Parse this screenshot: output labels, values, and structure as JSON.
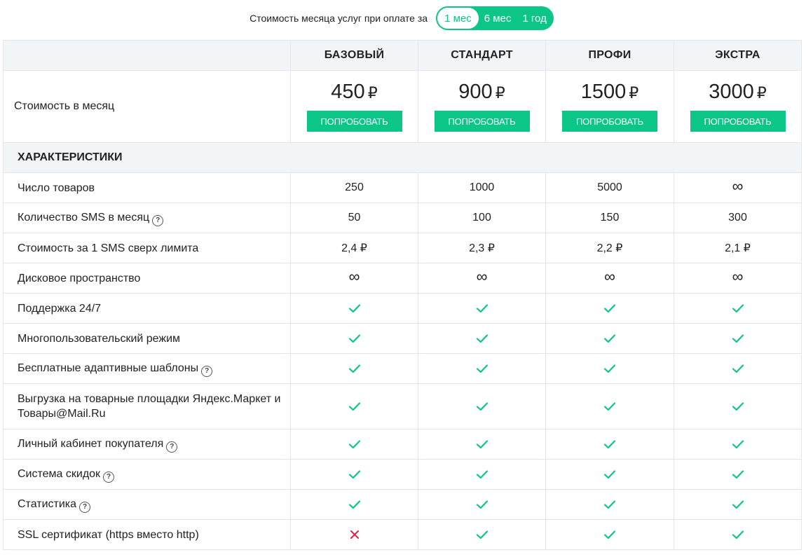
{
  "period": {
    "label": "Стоимость месяца услуг при оплате за",
    "options": [
      "1 мес",
      "6 мес",
      "1 год"
    ],
    "selected": 0
  },
  "colors": {
    "accent": "#0cc687",
    "cross": "#e0204a",
    "header_bg": "#f2f5f8"
  },
  "plans": [
    {
      "name": "БАЗОВЫЙ",
      "price": "450",
      "currency": "₽",
      "button": "ПОПРОБОВАТЬ"
    },
    {
      "name": "СТАНДАРТ",
      "price": "900",
      "currency": "₽",
      "button": "ПОПРОБОВАТЬ"
    },
    {
      "name": "ПРОФИ",
      "price": "1500",
      "currency": "₽",
      "button": "ПОПРОБОВАТЬ"
    },
    {
      "name": "ЭКСТРА",
      "price": "3000",
      "currency": "₽",
      "button": "ПОПРОБОВАТЬ"
    }
  ],
  "price_row_label": "Стоимость в месяц",
  "section_title": "ХАРАКТЕРИСТИКИ",
  "features": [
    {
      "label": "Число товаров",
      "help": false,
      "values": [
        {
          "t": "text",
          "v": "250"
        },
        {
          "t": "text",
          "v": "1000"
        },
        {
          "t": "text",
          "v": "5000"
        },
        {
          "t": "text",
          "v": "∞"
        }
      ]
    },
    {
      "label": "Количество SMS в месяц",
      "help": true,
      "values": [
        {
          "t": "text",
          "v": "50"
        },
        {
          "t": "text",
          "v": "100"
        },
        {
          "t": "text",
          "v": "150"
        },
        {
          "t": "text",
          "v": "300"
        }
      ]
    },
    {
      "label": "Стоимость за 1 SMS сверх лимита",
      "help": false,
      "values": [
        {
          "t": "text",
          "v": "2,4 ₽"
        },
        {
          "t": "text",
          "v": "2,3 ₽"
        },
        {
          "t": "text",
          "v": "2,2 ₽"
        },
        {
          "t": "text",
          "v": "2,1 ₽"
        }
      ]
    },
    {
      "label": "Дисковое пространство",
      "help": false,
      "values": [
        {
          "t": "text",
          "v": "∞"
        },
        {
          "t": "text",
          "v": "∞"
        },
        {
          "t": "text",
          "v": "∞"
        },
        {
          "t": "text",
          "v": "∞"
        }
      ]
    },
    {
      "label": "Поддержка 24/7",
      "help": false,
      "values": [
        {
          "t": "check"
        },
        {
          "t": "check"
        },
        {
          "t": "check"
        },
        {
          "t": "check"
        }
      ]
    },
    {
      "label": "Многопользовательский режим",
      "help": false,
      "values": [
        {
          "t": "check"
        },
        {
          "t": "check"
        },
        {
          "t": "check"
        },
        {
          "t": "check"
        }
      ]
    },
    {
      "label": "Бесплатные адаптивные шаблоны",
      "help": true,
      "values": [
        {
          "t": "check"
        },
        {
          "t": "check"
        },
        {
          "t": "check"
        },
        {
          "t": "check"
        }
      ]
    },
    {
      "label": "Выгрузка на товарные площадки Яндекс.Маркет и Товары@Mail.Ru",
      "help": false,
      "tall": true,
      "values": [
        {
          "t": "check"
        },
        {
          "t": "check"
        },
        {
          "t": "check"
        },
        {
          "t": "check"
        }
      ]
    },
    {
      "label": "Личный кабинет покупателя",
      "help": true,
      "values": [
        {
          "t": "check"
        },
        {
          "t": "check"
        },
        {
          "t": "check"
        },
        {
          "t": "check"
        }
      ]
    },
    {
      "label": "Система скидок",
      "help": true,
      "values": [
        {
          "t": "check"
        },
        {
          "t": "check"
        },
        {
          "t": "check"
        },
        {
          "t": "check"
        }
      ]
    },
    {
      "label": "Статистика",
      "help": true,
      "values": [
        {
          "t": "check"
        },
        {
          "t": "check"
        },
        {
          "t": "check"
        },
        {
          "t": "check"
        }
      ]
    },
    {
      "label": "SSL сертификат (https вместо http)",
      "help": false,
      "values": [
        {
          "t": "cross"
        },
        {
          "t": "check"
        },
        {
          "t": "check"
        },
        {
          "t": "check"
        }
      ]
    }
  ]
}
